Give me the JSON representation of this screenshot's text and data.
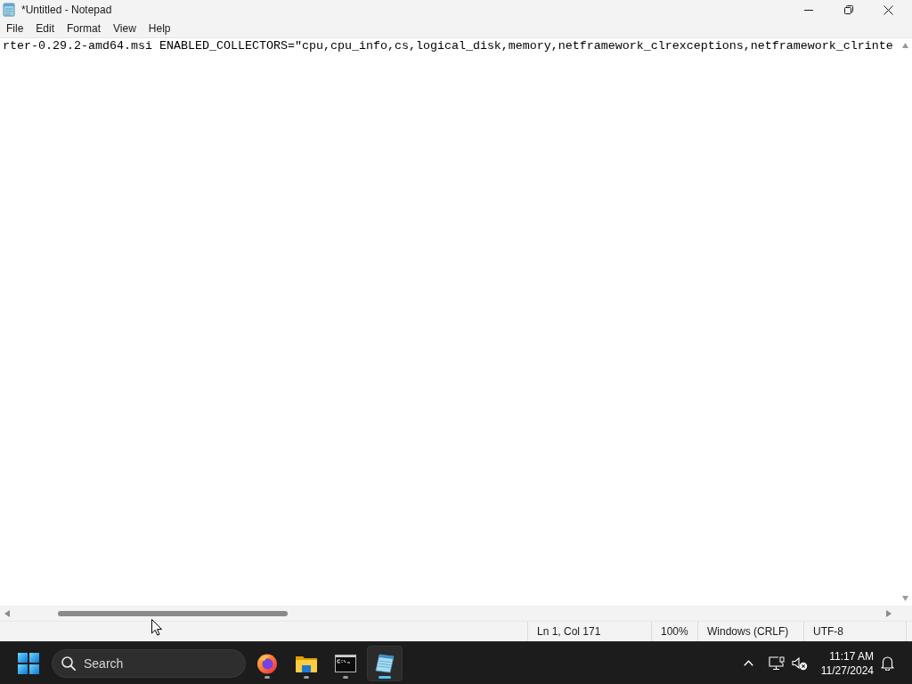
{
  "window": {
    "title": "*Untitled - Notepad"
  },
  "menu": [
    {
      "label": "File"
    },
    {
      "label": "Edit"
    },
    {
      "label": "Format"
    },
    {
      "label": "View"
    },
    {
      "label": "Help"
    }
  ],
  "editor": {
    "text": "rter-0.29.2-amd64.msi ENABLED_COLLECTORS=\"cpu,cpu_info,cs,logical_disk,memory,netframework_clrexceptions,netframework_clrinte"
  },
  "status_bar": [
    "Ln 1, Col 171",
    "100%",
    "Windows (CRLF)",
    "UTF-8"
  ],
  "taskbar": {
    "search": {
      "label": "Search"
    },
    "apps": [
      {
        "kind": "browser",
        "selected": false
      },
      {
        "kind": "folder",
        "selected": false
      },
      {
        "kind": "terminal",
        "selected": false
      },
      {
        "kind": "notepad",
        "selected": true
      }
    ],
    "clock": {
      "time": "11:17 AM",
      "date": "11/27/2024"
    }
  }
}
